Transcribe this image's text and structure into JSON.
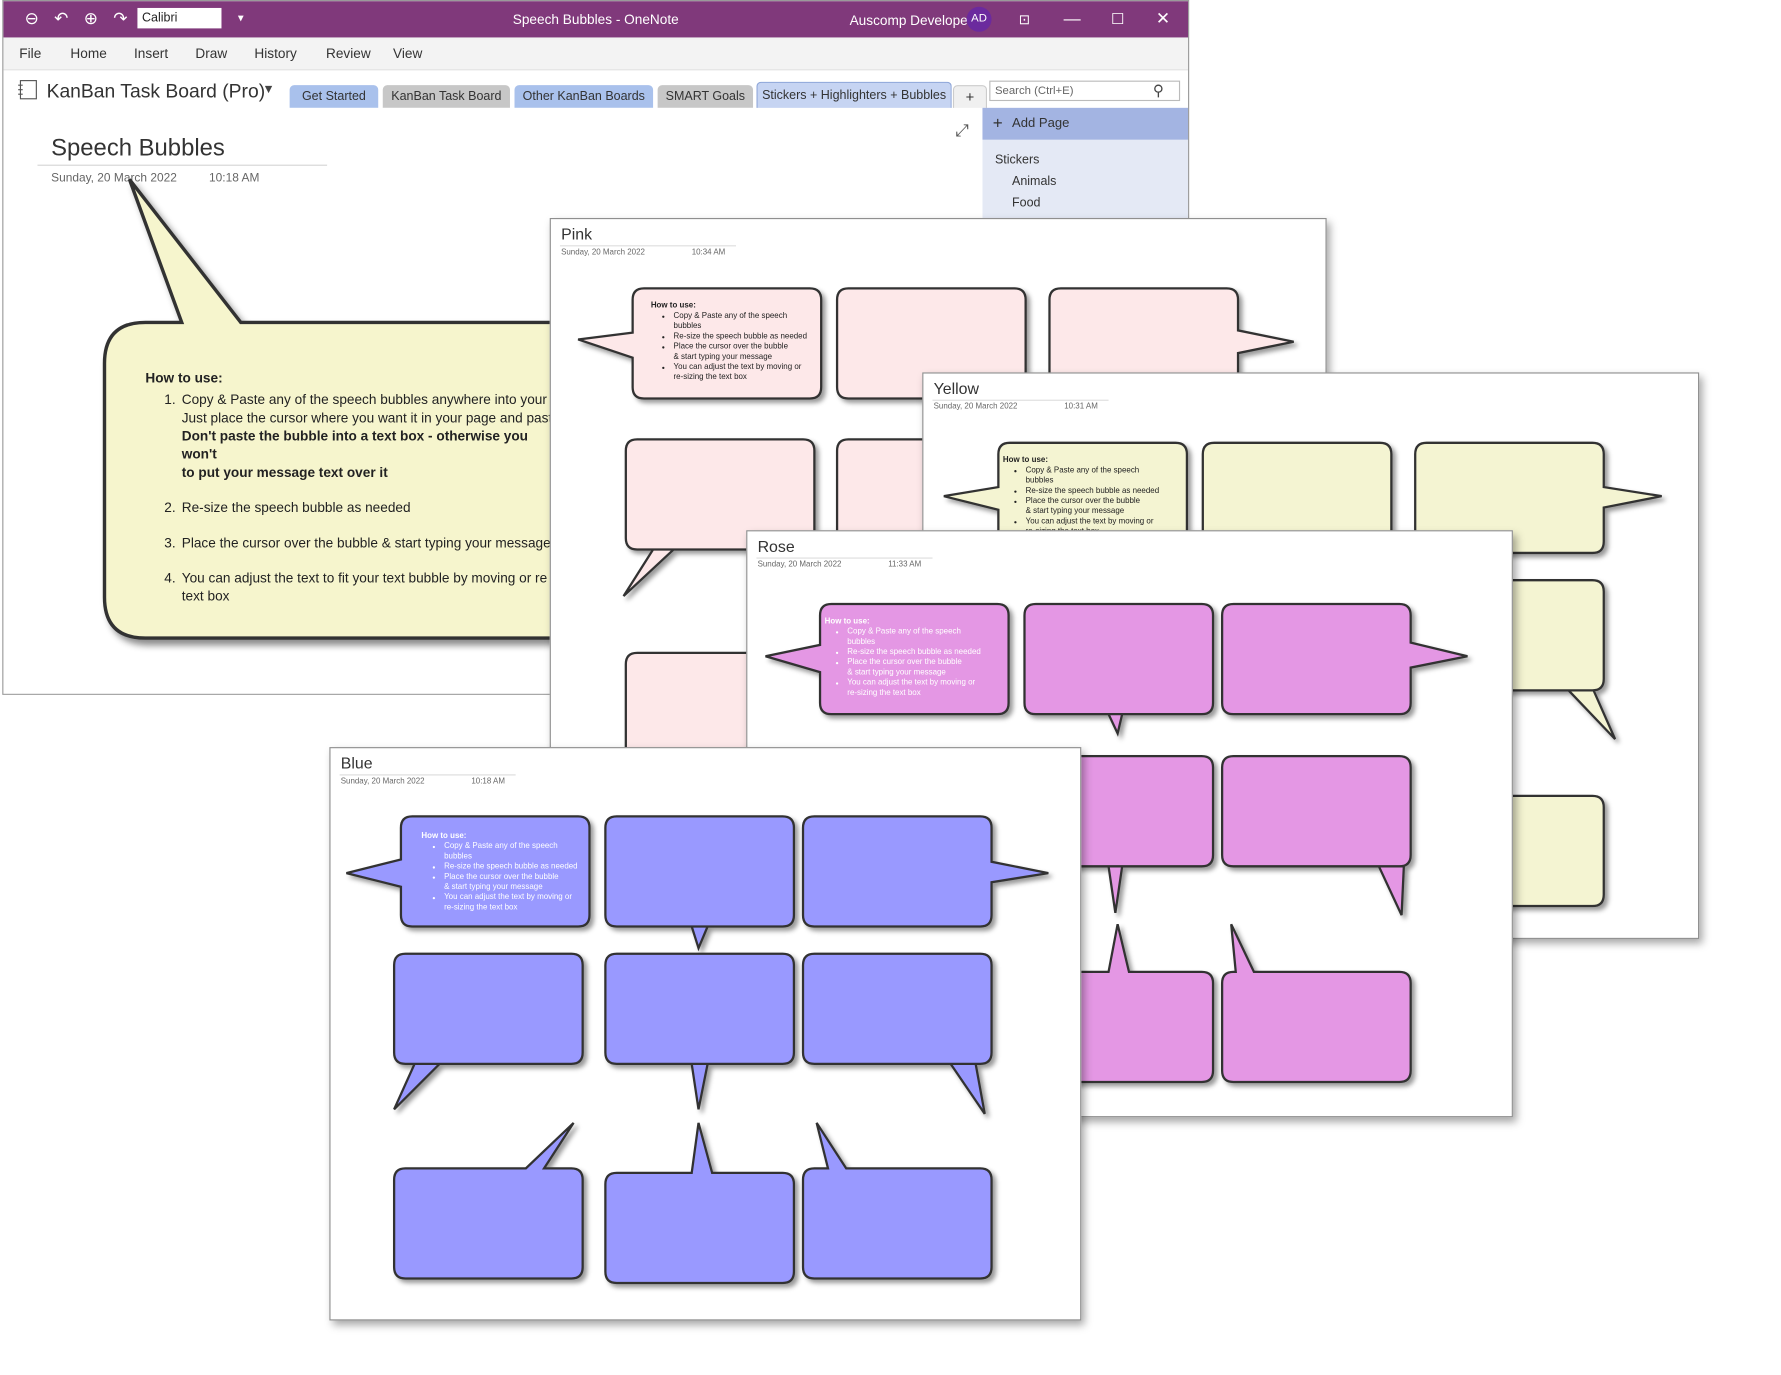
{
  "window": {
    "title": "Speech Bubbles  -  OneNote",
    "font_name": "Calibri",
    "user_name": "Auscomp Developer",
    "user_initials": "AD",
    "accent": "#80397b"
  },
  "menu": [
    "File",
    "Home",
    "Insert",
    "Draw",
    "History",
    "Review",
    "View"
  ],
  "notebook": {
    "name": "KanBan Task Board (Pro)",
    "sections": [
      {
        "label": "Get Started",
        "color": "#a9c1ec"
      },
      {
        "label": "KanBan Task Board",
        "color": "#c7c7c7"
      },
      {
        "label": "Other KanBan Boards",
        "color": "#a9c1ec"
      },
      {
        "label": "SMART Goals",
        "color": "#c7c7c7"
      },
      {
        "label": "Stickers + Highlighters + Bubbles",
        "color": "#a9c1ec"
      }
    ],
    "add_section": "+",
    "search_placeholder": "Search (Ctrl+E)"
  },
  "page": {
    "title": "Speech Bubbles",
    "date": "Sunday, 20 March 2022",
    "time": "10:18 AM",
    "bubble_fill": "#f6f5cd",
    "howto_title": "How to use:",
    "howto_steps": [
      {
        "text": "Copy & Paste any of the speech bubbles anywhere into your O",
        "line2": "Just place the cursor where you want it in your page and paste",
        "bold": "Don't paste the bubble into a text box - otherwise you won't",
        "bold2": "to put your message text over it"
      },
      {
        "text": "Re-size the speech bubble as needed"
      },
      {
        "text": "Place the cursor over the bubble & start typing your message"
      },
      {
        "text": "You can adjust the text to fit your text bubble by moving or re",
        "line2": "text box"
      }
    ]
  },
  "pages_panel": {
    "add_page": "Add Page",
    "items": [
      "Stickers",
      "Animals",
      "Food"
    ]
  },
  "sheets": [
    {
      "name": "Pink",
      "date": "Sunday, 20 March 2022",
      "time": "10:34 AM",
      "fill": "#fde8e9",
      "text_color": "#222222"
    },
    {
      "name": "Yellow",
      "date": "Sunday, 20 March 2022",
      "time": "10:31 AM",
      "fill": "#f4f4d2",
      "text_color": "#222222"
    },
    {
      "name": "Rose",
      "date": "Sunday, 20 March 2022",
      "time": "11:33 AM",
      "fill": "#e497e4",
      "text_color": "#ffffff"
    },
    {
      "name": "Blue",
      "date": "Sunday, 20 March 2022",
      "time": "10:18 AM",
      "fill": "#9999ff",
      "text_color": "#ffffff"
    }
  ],
  "mini_howto": {
    "title": "How to use:",
    "items": [
      "Copy & Paste any of the speech",
      "bubbles",
      "Re-size the speech bubble as needed",
      "Place the cursor over the bubble",
      "& start typing your message",
      "You can adjust the text by moving or",
      "re-sizing the text box"
    ]
  }
}
